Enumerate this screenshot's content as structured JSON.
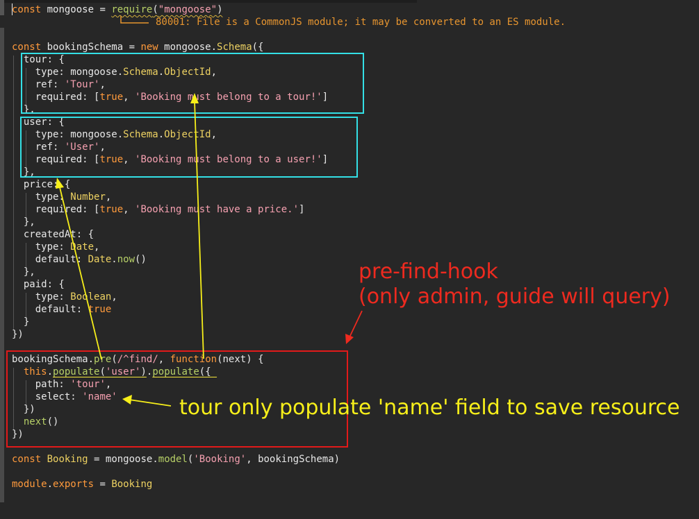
{
  "editor": {
    "language": "javascript",
    "colors": {
      "background": "#272727",
      "keyword": "#ff9a3c",
      "class": "#eed262",
      "string": "#f5a0b0",
      "function": "#b7d067",
      "diagnostic": "#e7952f"
    }
  },
  "diagnostic": {
    "message": "80001: File is a CommonJS module; it may be converted to an ES module."
  },
  "annotations": {
    "pre_find_hook_title": "pre-find-hook",
    "pre_find_hook_subtitle": "(only admin, guide will query)",
    "tour_note": "tour only populate 'name' field to save resource",
    "colors": {
      "highlight_box": "#33e0e6",
      "hook_box": "#e21a1a",
      "arrow": "#f7ef1a"
    }
  }
}
